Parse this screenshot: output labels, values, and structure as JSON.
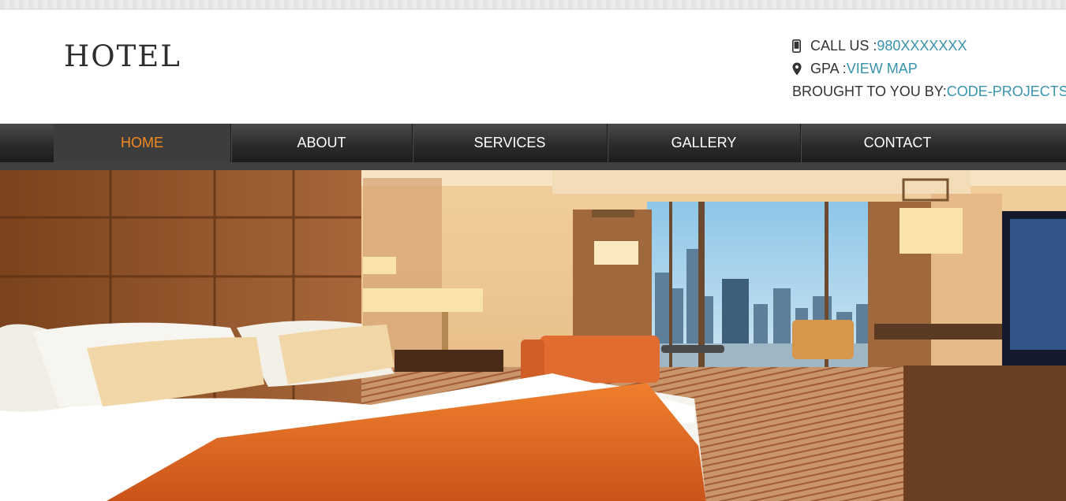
{
  "brand": {
    "logo_text": "HOTEL"
  },
  "contact": {
    "call_label": "CALL US : ",
    "call_value": "980XXXXXXX",
    "map_label": "GPA : ",
    "map_link": "VIEW MAP",
    "credit_label": "BROUGHT TO YOU BY:",
    "credit_link": "CODE-PROJECTS",
    "phone_icon": "phone-icon",
    "location_icon": "map-pin-icon"
  },
  "nav": {
    "items": [
      {
        "label": "HOME",
        "active": true
      },
      {
        "label": "ABOUT",
        "active": false
      },
      {
        "label": "SERVICES",
        "active": false
      },
      {
        "label": "GALLERY",
        "active": false
      },
      {
        "label": "CONTACT",
        "active": false
      }
    ]
  },
  "colors": {
    "accent": "#3a93ad",
    "nav_active": "#f58a1f",
    "nav_bg": "#2c2c2c",
    "bed_throw": "#e06a1f"
  }
}
